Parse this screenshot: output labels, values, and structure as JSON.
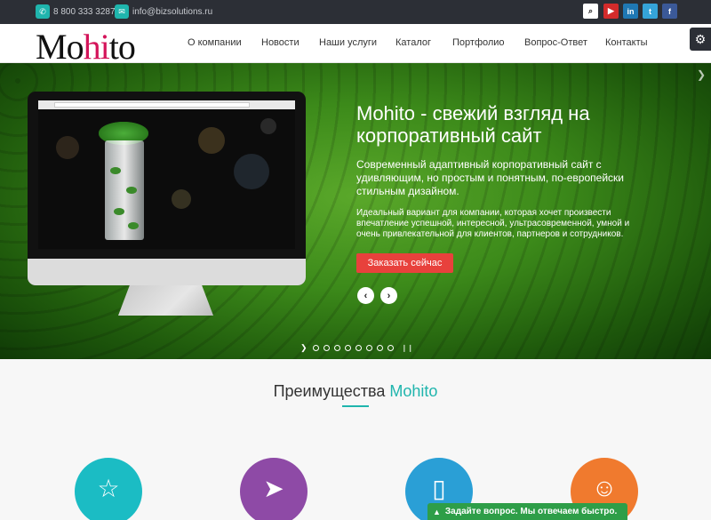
{
  "topbar": {
    "phone": "8 800 333 3287",
    "email": "info@bizsolutions.ru",
    "phone_icon": "phone-icon",
    "email_icon": "mail-icon"
  },
  "social": [
    {
      "name": "search-icon",
      "glyph": "⌕",
      "color": "#ffffff"
    },
    {
      "name": "youtube-icon",
      "glyph": "▶",
      "color": "#d32b2b"
    },
    {
      "name": "linkedin-icon",
      "glyph": "in",
      "color": "#1f78b4"
    },
    {
      "name": "twitter-icon",
      "glyph": "t",
      "color": "#35a4d9"
    },
    {
      "name": "facebook-icon",
      "glyph": "f",
      "color": "#3b5998"
    }
  ],
  "header": {
    "logo_pre": "Mo",
    "logo_hi": "hi",
    "logo_post": "to",
    "nav": [
      "О компании",
      "Новости",
      "Наши услуги",
      "Каталог",
      "Портфолио",
      "Вопрос-Ответ",
      "Контакты"
    ]
  },
  "hero": {
    "title": "Mohito - свежий взгляд на корпоративный сайт",
    "subtitle": "Современный адаптивный корпоративный сайт с удивляющим, но простым и понятным, по-европейски стильным дизайном.",
    "description": "Идеальный вариант для компании, которая хочет произвести впечатление успешной, интересной, ультрасовременной, умной и очень привлекательной для клиентов, партнеров и сотрудников.",
    "cta": "Заказать сейчас",
    "prev": "‹",
    "next": "›",
    "dots_count": 8
  },
  "advantages": {
    "title_pre": "Преимущества ",
    "title_brand": "Mohito",
    "items": [
      {
        "icon": "star-icon",
        "glyph": "☆",
        "color": "#1bbcc4"
      },
      {
        "icon": "paper-plane-icon",
        "glyph": "➤",
        "color": "#8e4aa6"
      },
      {
        "icon": "tablet-icon",
        "glyph": "▯",
        "color": "#2a9fd6"
      },
      {
        "icon": "person-icon",
        "glyph": "🯅",
        "color": "#f07a2e"
      }
    ]
  },
  "chat": {
    "label": "Задайте вопрос. Мы отвечаем быстро.",
    "icon": "chat-icon"
  }
}
